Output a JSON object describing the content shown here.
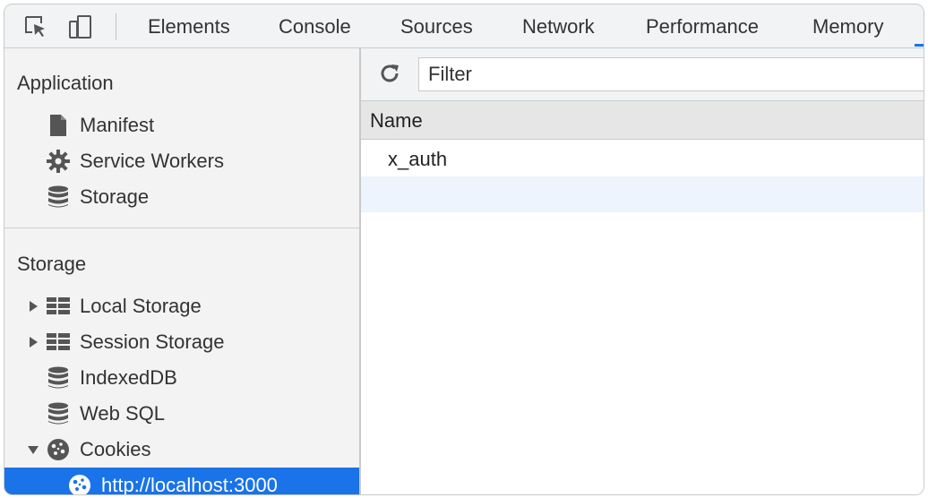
{
  "toolbar": {
    "inspect_icon": "inspect-element-icon",
    "device_icon": "device-toolbar-icon",
    "tabs": [
      "Elements",
      "Console",
      "Sources",
      "Network",
      "Performance",
      "Memory"
    ]
  },
  "sidebar": {
    "application": {
      "title": "Application",
      "items": [
        {
          "label": "Manifest",
          "icon": "file-icon"
        },
        {
          "label": "Service Workers",
          "icon": "gear-icon"
        },
        {
          "label": "Storage",
          "icon": "database-icon"
        }
      ]
    },
    "storage": {
      "title": "Storage",
      "items": [
        {
          "label": "Local Storage",
          "icon": "grid-icon",
          "expandable": true
        },
        {
          "label": "Session Storage",
          "icon": "grid-icon",
          "expandable": true
        },
        {
          "label": "IndexedDB",
          "icon": "database-icon"
        },
        {
          "label": "Web SQL",
          "icon": "database-icon"
        },
        {
          "label": "Cookies",
          "icon": "cookie-icon",
          "expanded": true
        },
        {
          "label": "http://localhost:3000",
          "icon": "cookie-icon",
          "selected": true
        }
      ]
    }
  },
  "main": {
    "filter_placeholder": "Filter",
    "columns": [
      "Name"
    ],
    "rows": [
      {
        "name": "x_auth"
      },
      {
        "name": ""
      }
    ]
  },
  "colors": {
    "accent": "#1a73e8",
    "selected_row": "#eef4fd"
  }
}
